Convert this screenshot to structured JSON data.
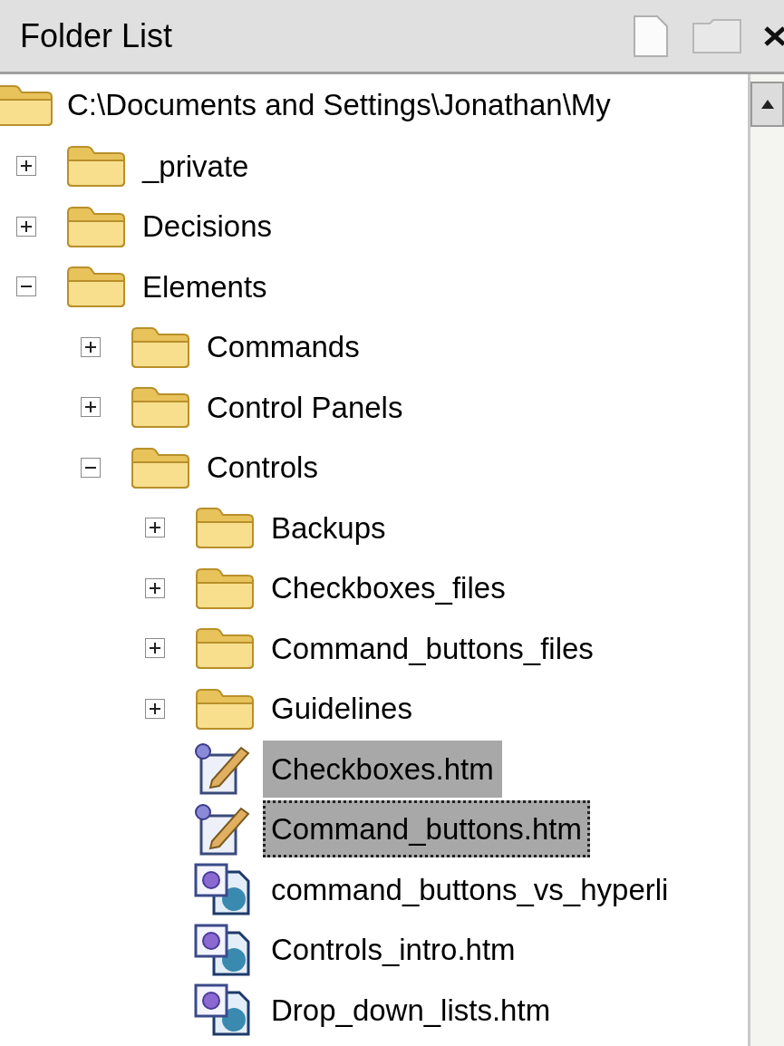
{
  "panel": {
    "title": "Folder List"
  },
  "root": {
    "label": "C:\\Documents and Settings\\Jonathan\\My"
  },
  "tree": [
    {
      "kind": "folder",
      "label": "_private",
      "expanded": false,
      "selected": false,
      "focused": false
    },
    {
      "kind": "folder",
      "label": "Decisions",
      "expanded": false,
      "selected": false,
      "focused": false
    },
    {
      "kind": "folder",
      "label": "Elements",
      "expanded": true,
      "selected": false,
      "focused": false,
      "children": [
        {
          "kind": "folder",
          "label": "Commands",
          "expanded": false,
          "selected": false,
          "focused": false
        },
        {
          "kind": "folder",
          "label": "Control Panels",
          "expanded": false,
          "selected": false,
          "focused": false
        },
        {
          "kind": "folder",
          "label": "Controls",
          "expanded": true,
          "selected": false,
          "focused": false,
          "children": [
            {
              "kind": "folder",
              "label": "Backups",
              "expanded": false,
              "selected": false,
              "focused": false
            },
            {
              "kind": "folder",
              "label": "Checkboxes_files",
              "expanded": false,
              "selected": false,
              "focused": false
            },
            {
              "kind": "folder",
              "label": "Command_buttons_files",
              "expanded": false,
              "selected": false,
              "focused": false
            },
            {
              "kind": "folder",
              "label": "Guidelines",
              "expanded": false,
              "selected": false,
              "focused": false
            },
            {
              "kind": "checked-out-page",
              "label": "Checkboxes.htm",
              "selected": true,
              "focused": false
            },
            {
              "kind": "checked-out-page",
              "label": "Command_buttons.htm",
              "selected": true,
              "focused": true
            },
            {
              "kind": "web-page",
              "label": "command_buttons_vs_hyperli",
              "selected": false,
              "focused": false
            },
            {
              "kind": "web-page",
              "label": "Controls_intro.htm",
              "selected": false,
              "focused": false
            },
            {
              "kind": "web-page",
              "label": "Drop_down_lists.htm",
              "selected": false,
              "focused": false
            }
          ]
        }
      ]
    }
  ]
}
